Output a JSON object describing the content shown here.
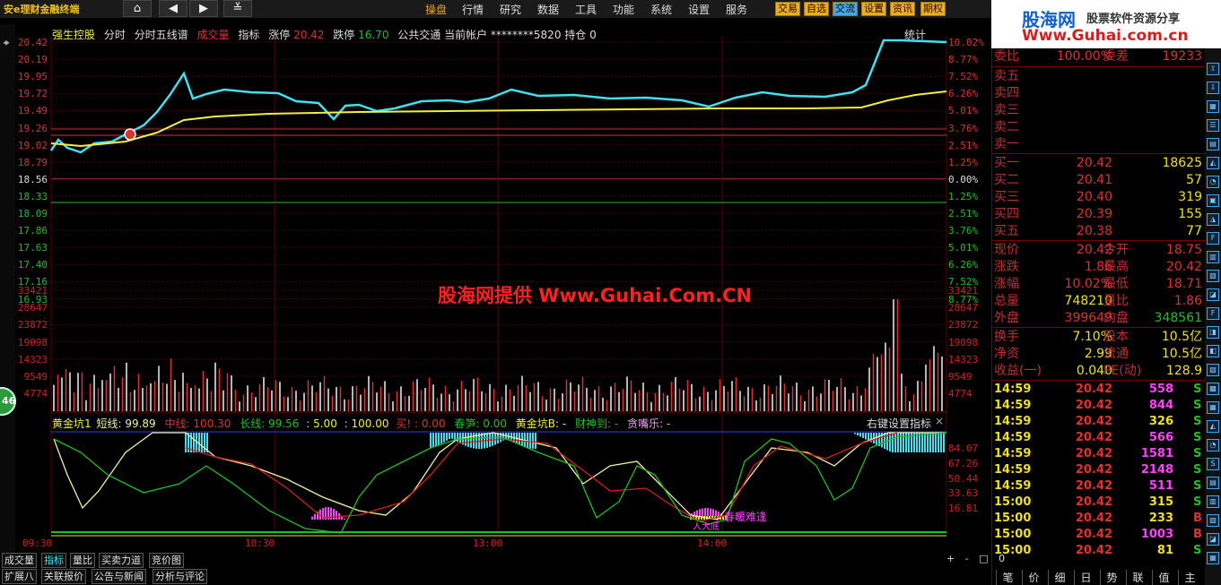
{
  "app": {
    "title": "安e理财金融终端",
    "watermark_top": "股海网",
    "watermark_top2": "股票软件资源分享",
    "watermark_url": "Www.Guhai.com.cn",
    "center_watermark": "股海网提供 Www.Guhai.Com.CN",
    "badge": "46"
  },
  "menu": [
    "操盘",
    "行情",
    "研究",
    "数据",
    "工具",
    "功能",
    "系统",
    "设置",
    "服务"
  ],
  "orange_buttons": [
    "交易",
    "自选",
    "交流",
    "设置",
    "资讯",
    "期权"
  ],
  "chart_header": {
    "name": "强生控股",
    "tabs": [
      "分时",
      "分时五线谱"
    ],
    "vol_label": "成交量",
    "ind_label": "指标",
    "up_label": "涨停",
    "up_val": "20.42",
    "down_label": "跌停",
    "down_val": "16.70",
    "account": "公共交通 当前帐户 ********5820 持仓 0",
    "stats": "统计"
  },
  "price_axis": [
    "20.42",
    "20.19",
    "19.95",
    "19.72",
    "19.49",
    "19.26",
    "19.02",
    "18.79",
    "18.56",
    "18.33",
    "18.09",
    "17.86",
    "17.63",
    "17.40",
    "17.16",
    "16.93"
  ],
  "pct_axis": [
    "10.02%",
    "8.77%",
    "7.52%",
    "6.26%",
    "5.01%",
    "3.76%",
    "2.51%",
    "1.25%",
    "0.00%",
    "1.25%",
    "2.51%",
    "3.76%",
    "5.01%",
    "6.26%",
    "7.52%",
    "8.77%"
  ],
  "vol_axis": [
    "33421",
    "28647",
    "23872",
    "19098",
    "14323",
    "9549",
    "4774"
  ],
  "ind_header": {
    "name": "黄金坑1",
    "short": "短线: 99.89",
    "mid": "中线: 100.30",
    "long": "长线: 99.56",
    "a": ": 5.00",
    "b": ": 100.00",
    "buy": "买!",
    "buyv": ": 0.00",
    "spring": "春笋: 0.00",
    "gold": "黄金坑B: -",
    "caishen": "财神到: -",
    "tan": "贪嘴乐: -",
    "settings": "右键设置指标",
    "close": "×"
  },
  "ind_axis": [
    "84.07",
    "67.26",
    "50.44",
    "33.63",
    "16.81"
  ],
  "ind_text": "春暖难逢",
  "ind_text2": "人大底",
  "time_axis": [
    "09:30",
    "10:30",
    "13:00",
    "14:00"
  ],
  "tabs_row1": [
    "成交量",
    "指标",
    "量比",
    "买卖力道",
    "竞价图"
  ],
  "tabs_row2": [
    "扩展八",
    "关联报价",
    "公告与新闻",
    "分析与评论"
  ],
  "nav_ctrl": [
    "+",
    "-",
    "□",
    "0"
  ],
  "quote": {
    "ratio_label": "委比",
    "ratio_val": "100.00%",
    "diff_label": "委差",
    "diff_val": "19233",
    "sells": [
      "卖五",
      "卖四",
      "卖三",
      "卖二",
      "卖一"
    ],
    "buys": [
      {
        "k": "买一",
        "p": "20.42",
        "v": "18625"
      },
      {
        "k": "买二",
        "p": "20.41",
        "v": "57"
      },
      {
        "k": "买三",
        "p": "20.40",
        "v": "319"
      },
      {
        "k": "买四",
        "p": "20.39",
        "v": "155"
      },
      {
        "k": "买五",
        "p": "20.38",
        "v": "77"
      }
    ],
    "stats": [
      {
        "k1": "现价",
        "v1": "20.42",
        "k2": "今开",
        "v2": "18.75"
      },
      {
        "k1": "涨跌",
        "v1": "1.86",
        "k2": "最高",
        "v2": "20.42"
      },
      {
        "k1": "涨幅",
        "v1": "10.02%",
        "k2": "最低",
        "v2": "18.71"
      },
      {
        "k1": "总量",
        "v1": "748210",
        "k2": "量比",
        "v2": "1.86"
      },
      {
        "k1": "外盘",
        "v1": "399649",
        "k2": "内盘",
        "v2": "348561"
      }
    ],
    "stats2": [
      {
        "k1": "换手",
        "v1": "7.10%",
        "k2": "股本",
        "v2": "10.5亿"
      },
      {
        "k1": "净资",
        "v1": "2.99",
        "k2": "流通",
        "v2": "10.5亿"
      },
      {
        "k1": "收益(一)",
        "v1": "0.040",
        "k2": "PE(动)",
        "v2": "128.9"
      }
    ]
  },
  "ticks": [
    {
      "t": "14:59",
      "p": "20.42",
      "v": "558",
      "s": "S"
    },
    {
      "t": "14:59",
      "p": "20.42",
      "v": "844",
      "s": "S"
    },
    {
      "t": "14:59",
      "p": "20.42",
      "v": "326",
      "s": "S"
    },
    {
      "t": "14:59",
      "p": "20.42",
      "v": "566",
      "s": "S"
    },
    {
      "t": "14:59",
      "p": "20.42",
      "v": "1581",
      "s": "S"
    },
    {
      "t": "14:59",
      "p": "20.42",
      "v": "2148",
      "s": "S"
    },
    {
      "t": "14:59",
      "p": "20.42",
      "v": "511",
      "s": "S"
    },
    {
      "t": "15:00",
      "p": "20.42",
      "v": "315",
      "s": "S"
    },
    {
      "t": "15:00",
      "p": "20.42",
      "v": "233",
      "s": "B"
    },
    {
      "t": "15:00",
      "p": "20.42",
      "v": "1003",
      "s": "B"
    },
    {
      "t": "15:00",
      "p": "20.42",
      "v": "81",
      "s": "S"
    }
  ],
  "bottom_tabs": [
    "笔",
    "价",
    "细",
    "日",
    "势",
    "联",
    "值",
    "主"
  ],
  "colors": {
    "price_line": "#40e0f0",
    "avg_line": "#f0f040",
    "up": "#e03030",
    "grid": "#500000",
    "green": "#20c020",
    "yellow": "#f0e020",
    "magenta": "#ff40ff"
  }
}
